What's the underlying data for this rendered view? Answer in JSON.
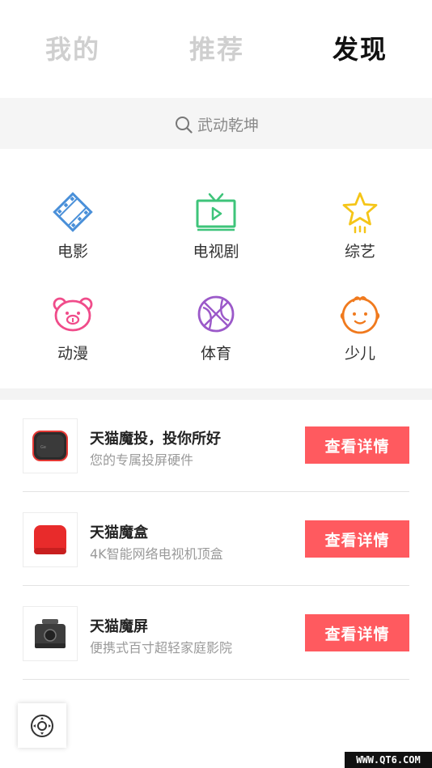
{
  "tabs": [
    {
      "label": "我的",
      "active": false
    },
    {
      "label": "推荐",
      "active": false
    },
    {
      "label": "发现",
      "active": true
    }
  ],
  "search": {
    "placeholder": "武动乾坤",
    "icon": "search-icon"
  },
  "categories": [
    {
      "label": "电影",
      "icon": "film-icon",
      "color": "#4a90d9"
    },
    {
      "label": "电视剧",
      "icon": "tv-icon",
      "color": "#3ec47a"
    },
    {
      "label": "综艺",
      "icon": "star-icon",
      "color": "#f5c518"
    },
    {
      "label": "动漫",
      "icon": "bear-icon",
      "color": "#f04c8a"
    },
    {
      "label": "体育",
      "icon": "basketball-icon",
      "color": "#9b59c9"
    },
    {
      "label": "少儿",
      "icon": "baby-face-icon",
      "color": "#f07a1e"
    }
  ],
  "products": [
    {
      "title": "天猫魔投，投你所好",
      "subtitle": "您的专属投屏硬件",
      "button": "查看详情",
      "image": "projector-dongle-image"
    },
    {
      "title": "天猫魔盒",
      "subtitle": "4K智能网络电视机顶盒",
      "button": "查看详情",
      "image": "tv-box-image"
    },
    {
      "title": "天猫魔屏",
      "subtitle": "便携式百寸超轻家庭影院",
      "button": "查看详情",
      "image": "portable-projector-image"
    }
  ],
  "floating_button": {
    "icon": "remote-control-icon"
  },
  "watermark": "WWW.QT6.COM",
  "colors": {
    "accent": "#ff5a5f",
    "tab_active": "#111111",
    "tab_inactive": "#cfcfcf"
  }
}
